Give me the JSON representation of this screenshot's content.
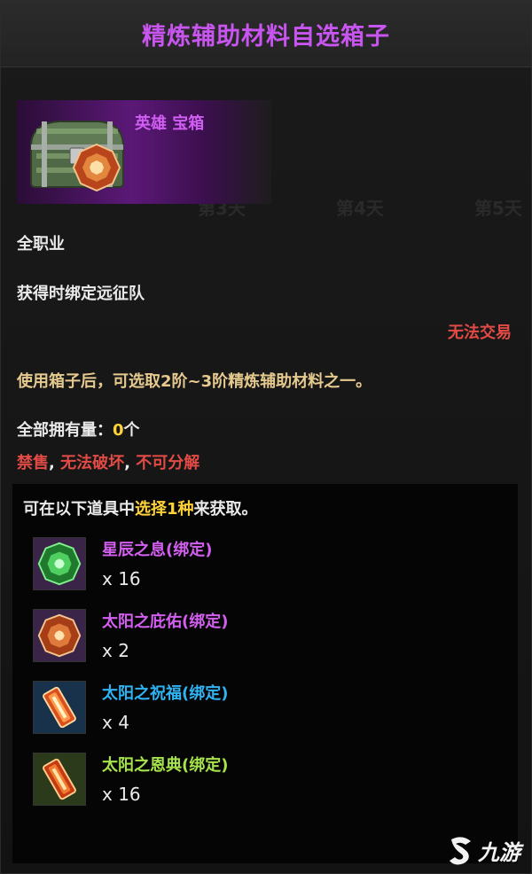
{
  "title": "精炼辅助材料自选箱子",
  "item": {
    "grade_label": "英雄 宝箱",
    "icon": "treasure-chest-icon"
  },
  "info": {
    "class": "全职业",
    "bind": "获得时绑定远征队",
    "trade": "无法交易",
    "description": "使用箱子后，可选取2阶~3阶精炼辅助材料之一。",
    "owned_label": "全部拥有量：",
    "owned_value": "0",
    "owned_unit": "个",
    "restrictions": [
      "禁售",
      "无法破坏",
      "不可分解"
    ],
    "restriction_sep": ", "
  },
  "rewards": {
    "intro_prefix": "可在以下道具中",
    "intro_highlight": "选择1种",
    "intro_suffix": "来获取。",
    "items": [
      {
        "name": "星辰之息(绑定)",
        "qty": "x 16",
        "color": "#d35ff0",
        "icon": "green-gem-icon"
      },
      {
        "name": "太阳之庇佑(绑定)",
        "qty": "x 2",
        "color": "#d35ff0",
        "icon": "sun-gem-icon"
      },
      {
        "name": "太阳之祝福(绑定)",
        "qty": "x 4",
        "color": "#2fb3f2",
        "icon": "blessing-crystal-icon"
      },
      {
        "name": "太阳之恩典(绑定)",
        "qty": "x 16",
        "color": "#a6e34a",
        "icon": "grace-crystal-icon"
      }
    ]
  },
  "watermark": "九游",
  "colors": {
    "epic": "#c855f0",
    "rare": "#2fb3f2",
    "uncommon": "#a6e34a",
    "warning": "#e24b45",
    "description": "#e5c98e",
    "highlight": "#ffd23a"
  }
}
